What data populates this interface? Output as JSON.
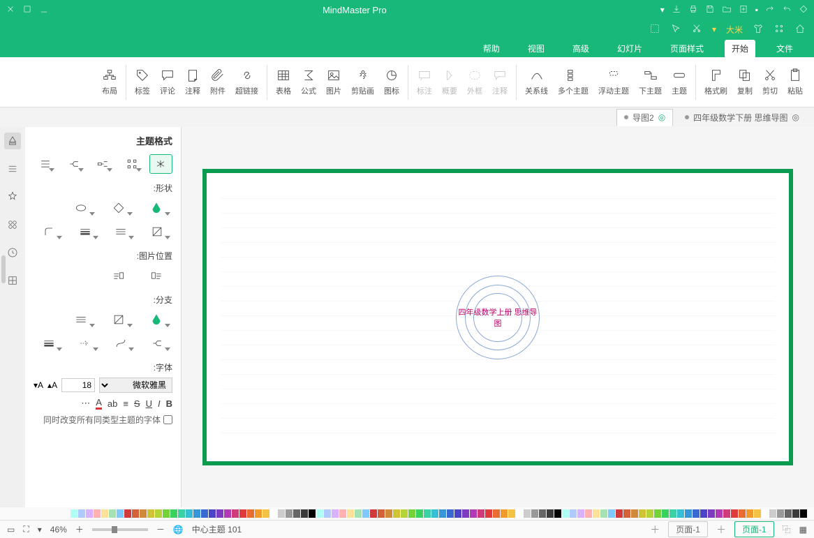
{
  "app": {
    "title": "MindMaster Pro"
  },
  "menus": {
    "file": "文件",
    "start": "开始",
    "pageStyle": "页面样式",
    "slideshow": "幻灯片",
    "advanced": "高级",
    "view": "视图",
    "help": "帮助"
  },
  "ribbon": {
    "paste": "粘贴",
    "cut": "剪切",
    "copy": "复制",
    "format": "格式刷",
    "topic": "主题",
    "subTopic": "下主题",
    "floatTopic": "浮动主题",
    "multiTopic": "多个主题",
    "relation": "关系线",
    "callout": "注释",
    "boundary": "外框",
    "summary": "概要",
    "mark": "标注",
    "chart": "图标",
    "clipart": "剪贴画",
    "picture": "图片",
    "formula": "公式",
    "table": "表格",
    "hyperlink": "超链接",
    "attachment": "附件",
    "note": "注释",
    "comment": "评论",
    "tag": "标签",
    "layout": "布局"
  },
  "docTabs": {
    "t1": "四年级数学下册 思维导图",
    "t2": "导图2"
  },
  "panel": {
    "title": "主题格式",
    "shape": "形状:",
    "imgPos": "图片位置:",
    "branch": "分支:",
    "font": "字体:",
    "fontName": "微软雅黑",
    "fontSize": "18",
    "checkbox": "同时改变所有同类型主题的字体"
  },
  "canvas": {
    "center": "四年级数学上册 思维导图"
  },
  "palette": [
    "#000000",
    "#3b3b3b",
    "#666666",
    "#999999",
    "#cccccc",
    "#ffffff",
    "#f5c343",
    "#f19b2c",
    "#e86b32",
    "#de3b3b",
    "#d13a7b",
    "#b13ab5",
    "#7e3ac0",
    "#4c44c6",
    "#3a6ad1",
    "#3a97d6",
    "#3abed1",
    "#3ad1a4",
    "#3ad162",
    "#74d13a",
    "#b9d13a",
    "#d1c23a",
    "#d18a3a",
    "#d1613a",
    "#d13a3a",
    "#7dc9ff",
    "#a4e3b4",
    "#ffe29a",
    "#ffb1b1",
    "#d7b1ff",
    "#b1c9ff",
    "#b1fff4"
  ],
  "status": {
    "pageTab": "页面-1",
    "pageTab2": "页面-1",
    "zoom": "46%",
    "nodeCount": "101 中心主题"
  },
  "qbText": "大米"
}
